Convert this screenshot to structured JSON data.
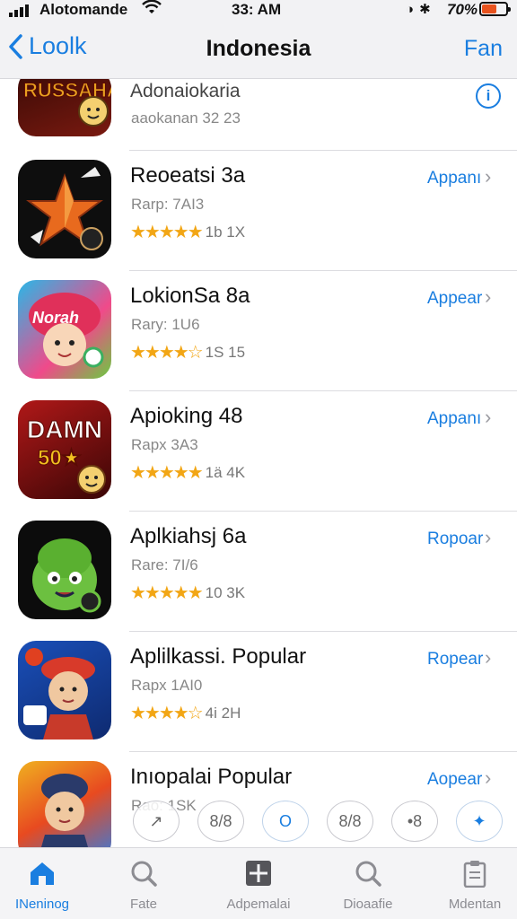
{
  "status_bar": {
    "carrier": "Alotomande",
    "time": "33: AM",
    "battery": "70%"
  },
  "nav": {
    "back_label": "Loolk",
    "title": "Indonesia",
    "right_label": "Fan"
  },
  "apps": [
    {
      "name": "Adonaiokaria",
      "rank": "aaokanan 32 23",
      "icon": "fighter-game-icon",
      "colors": [
        "#7a1a10",
        "#e8a020"
      ]
    },
    {
      "name": "Reoeatsi 3a",
      "rank": "Rarp: 7AI3",
      "stars": "★★★★★",
      "rating_text": "1b 1X",
      "get_label": "Appanı",
      "icon": "origami-star-icon",
      "colors": [
        "#111111",
        "#e86a1e"
      ]
    },
    {
      "name": "LokionSa 8a",
      "rank": "Rary: 1U6",
      "stars": "★★★★☆",
      "rating_text": "1S 15",
      "get_label": "Appear",
      "icon": "cartoon-girl-icon",
      "colors": [
        "#2aa8e0",
        "#e03a6a"
      ]
    },
    {
      "name": "Apioking 48",
      "rank": "Rapx 3A3",
      "stars": "★★★★★",
      "rating_text": "1ä 4K",
      "get_label": "Appanı",
      "icon": "damn-badge-icon",
      "colors": [
        "#8a1010",
        "#f2c020"
      ]
    },
    {
      "name": "Aplkiahsj 6a",
      "rank": "Rare: 7I/6",
      "stars": "★★★★★",
      "rating_text": "10 3K",
      "get_label": "Ropoar",
      "icon": "green-monster-icon",
      "colors": [
        "#111111",
        "#6cc040"
      ]
    },
    {
      "name": "Aplilkassi. Popular",
      "rank": "Rapx 1AI0",
      "stars": "★★★★☆",
      "rating_text": "4i 2H",
      "get_label": "Ropear",
      "icon": "cartoon-boy-icon",
      "colors": [
        "#1a4fb8",
        "#d83a2a"
      ]
    },
    {
      "name": "Inıopalai Popular",
      "rank": "Rao: 1SK",
      "get_label": "Aopear",
      "icon": "cartoon-student-icon",
      "colors": [
        "#f0b020",
        "#3a7ad8"
      ]
    }
  ],
  "quick_actions": [
    "↗",
    "8/8",
    "O",
    "8/8",
    "•8",
    "✦"
  ],
  "tabs": [
    {
      "label": "INeninog",
      "icon": "home-icon",
      "active": true
    },
    {
      "label": "Fate",
      "icon": "search-icon",
      "active": false
    },
    {
      "label": "Adpemalai",
      "icon": "apps-grid-icon",
      "active": false
    },
    {
      "label": "Dioaafie",
      "icon": "search-icon",
      "active": false
    },
    {
      "label": "Mdentan",
      "icon": "clipboard-icon",
      "active": false
    }
  ],
  "colors": {
    "accent": "#1a7ee0",
    "star": "#f2a615"
  }
}
